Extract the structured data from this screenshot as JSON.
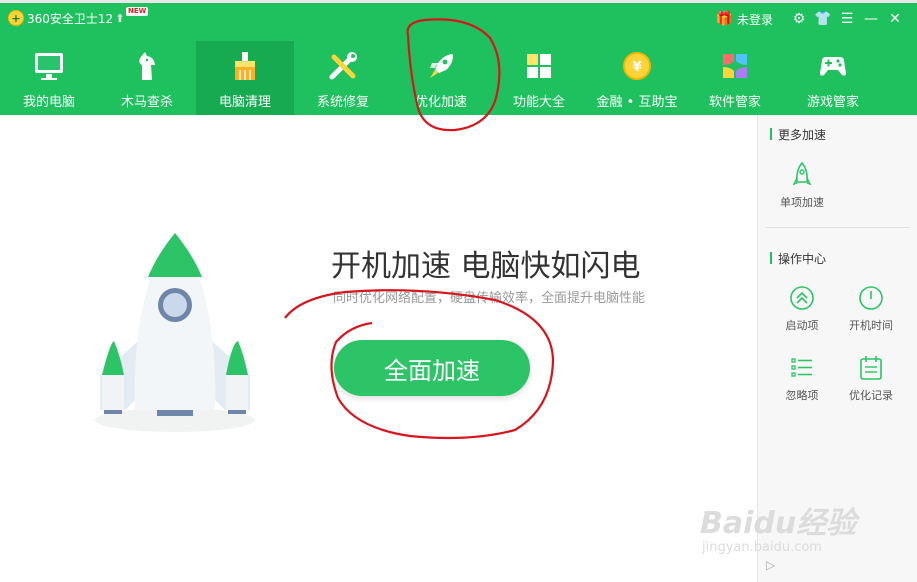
{
  "app": {
    "title": "360安全卫士12",
    "new_badge": "NEW",
    "login_label": "未登录"
  },
  "nav": {
    "items": [
      {
        "label": "我的电脑",
        "icon": "monitor-icon"
      },
      {
        "label": "木马查杀",
        "icon": "horse-icon"
      },
      {
        "label": "电脑清理",
        "icon": "brush-icon",
        "active": true
      },
      {
        "label": "系统修复",
        "icon": "wrench-icon"
      },
      {
        "label": "优化加速",
        "icon": "rocket-icon"
      },
      {
        "label": "功能大全",
        "icon": "grid-icon"
      },
      {
        "label": "金融 • 互助宝",
        "icon": "coin-icon"
      },
      {
        "label": "软件管家",
        "icon": "apps-icon"
      },
      {
        "label": "游戏管家",
        "icon": "gamepad-icon"
      }
    ]
  },
  "main": {
    "headline": "开机加速 电脑快如闪电",
    "subline": "同时优化网络配置，硬盘传输效率，全面提升电脑性能",
    "button_label": "全面加速"
  },
  "sidebar": {
    "more_title": "更多加速",
    "single_label": "单项加速",
    "ops_title": "操作中心",
    "ops_items": [
      {
        "label": "启动项",
        "icon": "startup-icon"
      },
      {
        "label": "开机时间",
        "icon": "clock-icon"
      },
      {
        "label": "忽略项",
        "icon": "list-icon"
      },
      {
        "label": "优化记录",
        "icon": "record-icon"
      }
    ]
  },
  "watermark": {
    "brand": "Baidu经验",
    "url": "jingyan.baidu.com"
  },
  "colors": {
    "brand_green": "#1fc15f",
    "active_tab": "#16aa51",
    "button_green": "#2cc467",
    "annotation_red": "#d8141c"
  }
}
